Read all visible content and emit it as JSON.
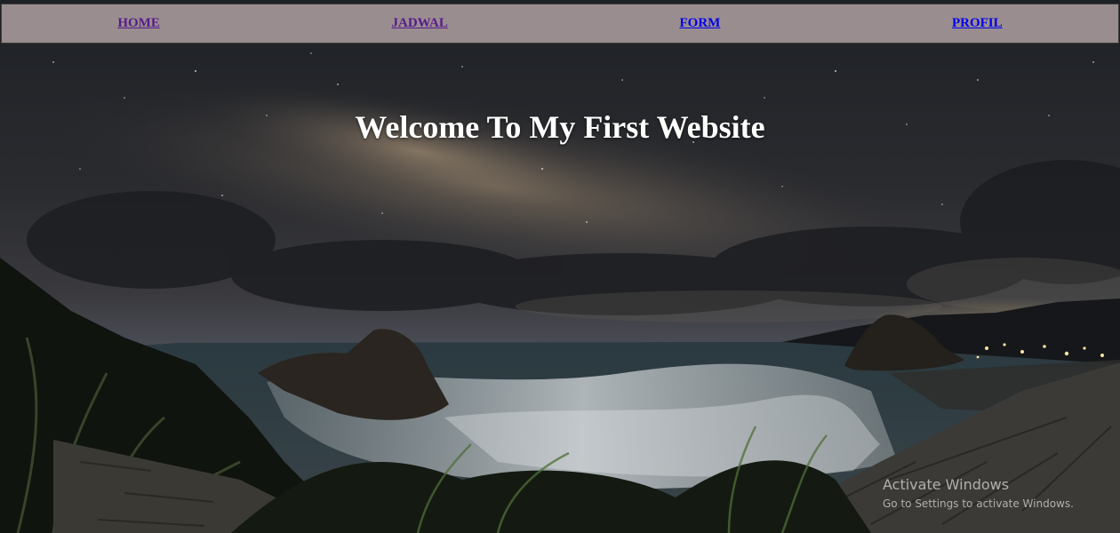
{
  "nav": {
    "items": [
      {
        "label": "HOME",
        "state": "visited"
      },
      {
        "label": "JADWAL",
        "state": "visited"
      },
      {
        "label": "FORM",
        "state": "link"
      },
      {
        "label": "PROFIL",
        "state": "link"
      }
    ]
  },
  "hero": {
    "title": "Welcome To My First Website"
  },
  "watermark": {
    "title": "Activate Windows",
    "subtitle": "Go to Settings to activate Windows."
  },
  "colors": {
    "navbar_bg": "#9a8d8f",
    "link": "#0000ee",
    "visited": "#551a8b",
    "title": "#ffffff"
  },
  "background_image": "night-sky-milky-way-over-coastal-beach-icon"
}
